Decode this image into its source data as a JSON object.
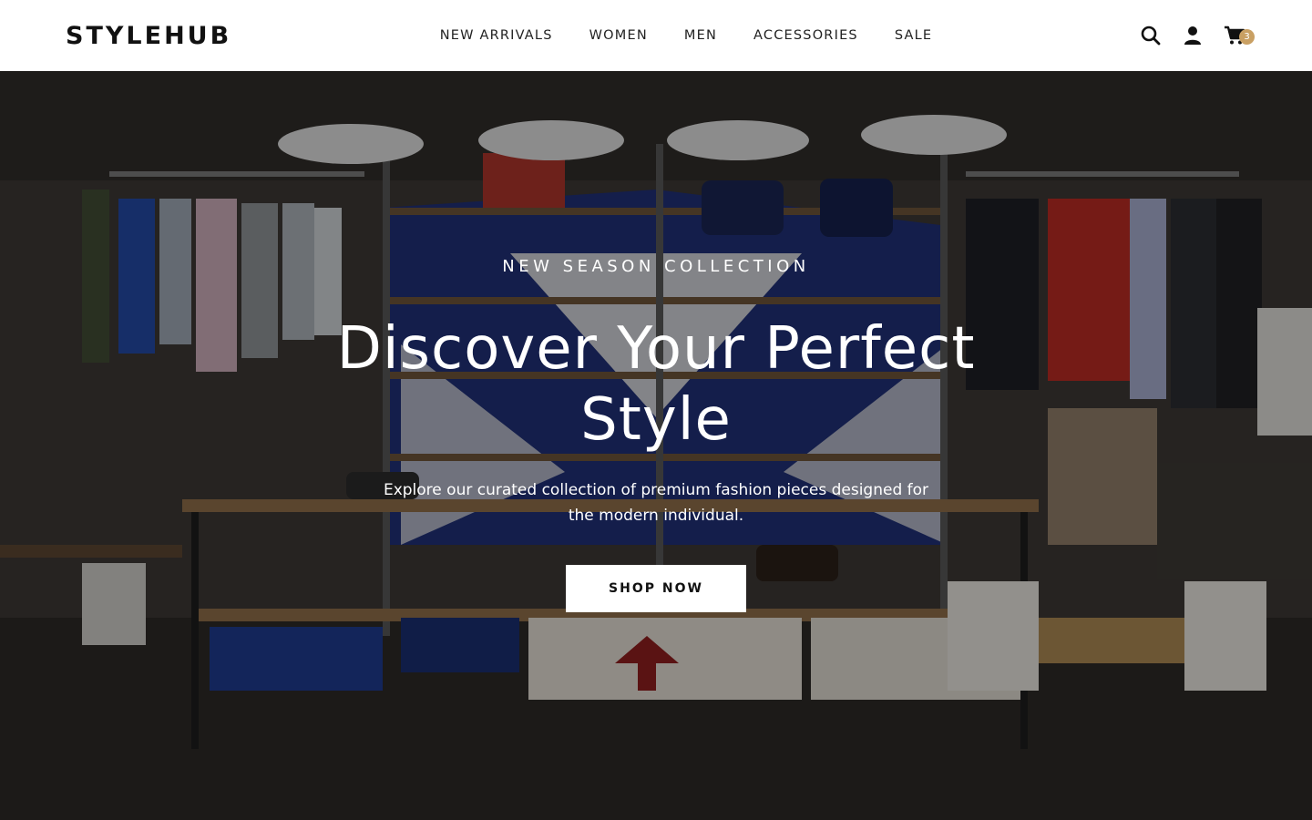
{
  "brand": {
    "logo": "STYLEHUB"
  },
  "nav": {
    "items": [
      {
        "label": "NEW ARRIVALS"
      },
      {
        "label": "WOMEN"
      },
      {
        "label": "MEN"
      },
      {
        "label": "ACCESSORIES"
      },
      {
        "label": "SALE"
      }
    ]
  },
  "header_icons": {
    "search": "search-icon",
    "account": "user-icon",
    "cart": "cart-icon",
    "cart_count": "3"
  },
  "hero": {
    "eyebrow": "NEW SEASON COLLECTION",
    "title": "Discover Your Perfect Style",
    "subtitle": "Explore our curated collection of premium fashion pieces designed for the modern individual.",
    "cta_label": "SHOP NOW",
    "background": "clothing-store-photo"
  },
  "colors": {
    "header_bg": "#ffffff",
    "text_dark": "#111111",
    "badge": "#c9a063",
    "cta_bg": "#ffffff"
  }
}
